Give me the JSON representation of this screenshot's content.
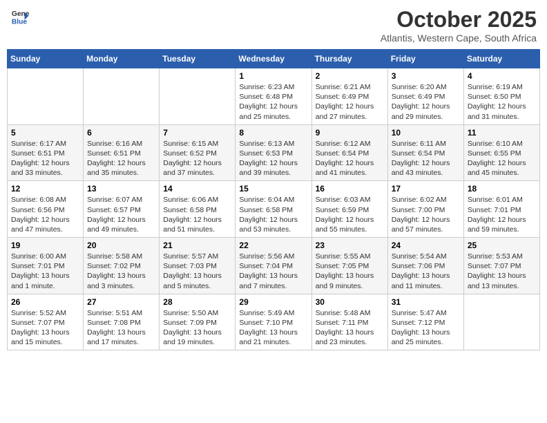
{
  "header": {
    "logo_line1": "General",
    "logo_line2": "Blue",
    "month": "October 2025",
    "location": "Atlantis, Western Cape, South Africa"
  },
  "weekdays": [
    "Sunday",
    "Monday",
    "Tuesday",
    "Wednesday",
    "Thursday",
    "Friday",
    "Saturday"
  ],
  "weeks": [
    [
      {
        "day": "",
        "info": ""
      },
      {
        "day": "",
        "info": ""
      },
      {
        "day": "",
        "info": ""
      },
      {
        "day": "1",
        "info": "Sunrise: 6:23 AM\nSunset: 6:48 PM\nDaylight: 12 hours\nand 25 minutes."
      },
      {
        "day": "2",
        "info": "Sunrise: 6:21 AM\nSunset: 6:49 PM\nDaylight: 12 hours\nand 27 minutes."
      },
      {
        "day": "3",
        "info": "Sunrise: 6:20 AM\nSunset: 6:49 PM\nDaylight: 12 hours\nand 29 minutes."
      },
      {
        "day": "4",
        "info": "Sunrise: 6:19 AM\nSunset: 6:50 PM\nDaylight: 12 hours\nand 31 minutes."
      }
    ],
    [
      {
        "day": "5",
        "info": "Sunrise: 6:17 AM\nSunset: 6:51 PM\nDaylight: 12 hours\nand 33 minutes."
      },
      {
        "day": "6",
        "info": "Sunrise: 6:16 AM\nSunset: 6:51 PM\nDaylight: 12 hours\nand 35 minutes."
      },
      {
        "day": "7",
        "info": "Sunrise: 6:15 AM\nSunset: 6:52 PM\nDaylight: 12 hours\nand 37 minutes."
      },
      {
        "day": "8",
        "info": "Sunrise: 6:13 AM\nSunset: 6:53 PM\nDaylight: 12 hours\nand 39 minutes."
      },
      {
        "day": "9",
        "info": "Sunrise: 6:12 AM\nSunset: 6:54 PM\nDaylight: 12 hours\nand 41 minutes."
      },
      {
        "day": "10",
        "info": "Sunrise: 6:11 AM\nSunset: 6:54 PM\nDaylight: 12 hours\nand 43 minutes."
      },
      {
        "day": "11",
        "info": "Sunrise: 6:10 AM\nSunset: 6:55 PM\nDaylight: 12 hours\nand 45 minutes."
      }
    ],
    [
      {
        "day": "12",
        "info": "Sunrise: 6:08 AM\nSunset: 6:56 PM\nDaylight: 12 hours\nand 47 minutes."
      },
      {
        "day": "13",
        "info": "Sunrise: 6:07 AM\nSunset: 6:57 PM\nDaylight: 12 hours\nand 49 minutes."
      },
      {
        "day": "14",
        "info": "Sunrise: 6:06 AM\nSunset: 6:58 PM\nDaylight: 12 hours\nand 51 minutes."
      },
      {
        "day": "15",
        "info": "Sunrise: 6:04 AM\nSunset: 6:58 PM\nDaylight: 12 hours\nand 53 minutes."
      },
      {
        "day": "16",
        "info": "Sunrise: 6:03 AM\nSunset: 6:59 PM\nDaylight: 12 hours\nand 55 minutes."
      },
      {
        "day": "17",
        "info": "Sunrise: 6:02 AM\nSunset: 7:00 PM\nDaylight: 12 hours\nand 57 minutes."
      },
      {
        "day": "18",
        "info": "Sunrise: 6:01 AM\nSunset: 7:01 PM\nDaylight: 12 hours\nand 59 minutes."
      }
    ],
    [
      {
        "day": "19",
        "info": "Sunrise: 6:00 AM\nSunset: 7:01 PM\nDaylight: 13 hours\nand 1 minute."
      },
      {
        "day": "20",
        "info": "Sunrise: 5:58 AM\nSunset: 7:02 PM\nDaylight: 13 hours\nand 3 minutes."
      },
      {
        "day": "21",
        "info": "Sunrise: 5:57 AM\nSunset: 7:03 PM\nDaylight: 13 hours\nand 5 minutes."
      },
      {
        "day": "22",
        "info": "Sunrise: 5:56 AM\nSunset: 7:04 PM\nDaylight: 13 hours\nand 7 minutes."
      },
      {
        "day": "23",
        "info": "Sunrise: 5:55 AM\nSunset: 7:05 PM\nDaylight: 13 hours\nand 9 minutes."
      },
      {
        "day": "24",
        "info": "Sunrise: 5:54 AM\nSunset: 7:06 PM\nDaylight: 13 hours\nand 11 minutes."
      },
      {
        "day": "25",
        "info": "Sunrise: 5:53 AM\nSunset: 7:07 PM\nDaylight: 13 hours\nand 13 minutes."
      }
    ],
    [
      {
        "day": "26",
        "info": "Sunrise: 5:52 AM\nSunset: 7:07 PM\nDaylight: 13 hours\nand 15 minutes."
      },
      {
        "day": "27",
        "info": "Sunrise: 5:51 AM\nSunset: 7:08 PM\nDaylight: 13 hours\nand 17 minutes."
      },
      {
        "day": "28",
        "info": "Sunrise: 5:50 AM\nSunset: 7:09 PM\nDaylight: 13 hours\nand 19 minutes."
      },
      {
        "day": "29",
        "info": "Sunrise: 5:49 AM\nSunset: 7:10 PM\nDaylight: 13 hours\nand 21 minutes."
      },
      {
        "day": "30",
        "info": "Sunrise: 5:48 AM\nSunset: 7:11 PM\nDaylight: 13 hours\nand 23 minutes."
      },
      {
        "day": "31",
        "info": "Sunrise: 5:47 AM\nSunset: 7:12 PM\nDaylight: 13 hours\nand 25 minutes."
      },
      {
        "day": "",
        "info": ""
      }
    ]
  ]
}
